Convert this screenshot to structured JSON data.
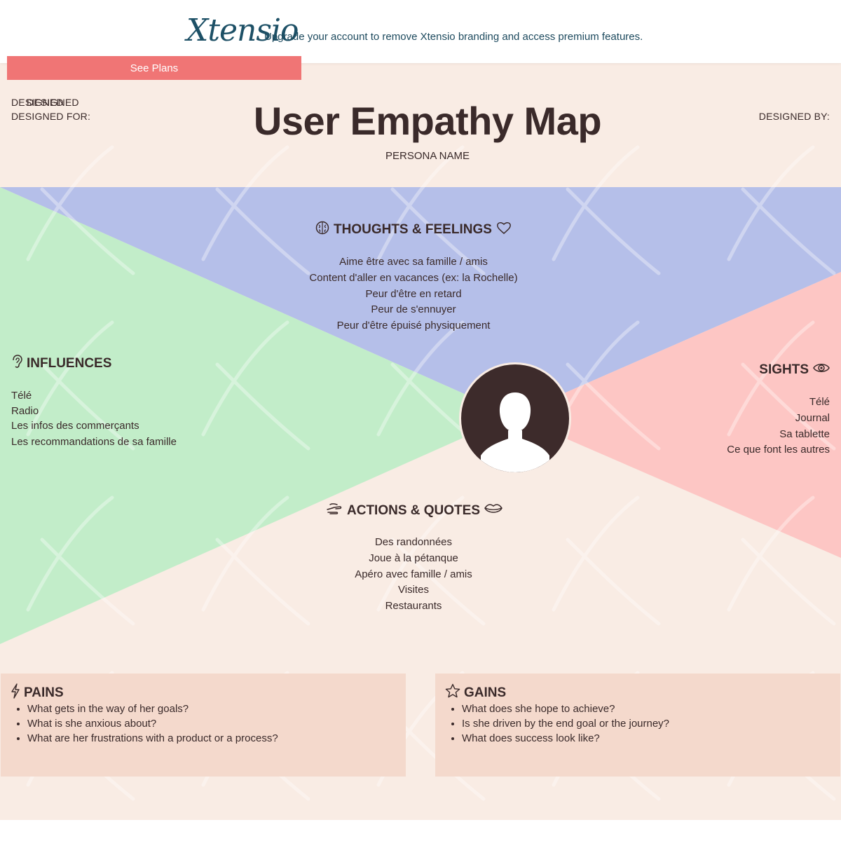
{
  "banner": {
    "logo_text": "Xtensio",
    "message": "Upgrade your account to remove Xtensio branding and access premium features.",
    "see_plans_label": "See Plans"
  },
  "header": {
    "designed_label_overlap": "DESIGNED",
    "designed_for_label": "DESIGNED FOR:",
    "designed_by_label": "DESIGNED BY:",
    "title": "User Empathy Map",
    "persona_name": "PERSONA NAME"
  },
  "sections": {
    "thoughts": {
      "title": "THOUGHTS & FEELINGS",
      "icon": "brain-icon",
      "icon_after": "heart-icon",
      "items": [
        "Aime être avec sa famille / amis",
        "Content d'aller en vacances (ex: la Rochelle)",
        "Peur d'être en retard",
        "Peur de s'ennuyer",
        "Peur d'être épuisé physiquement"
      ]
    },
    "influences": {
      "title": "INFLUENCES",
      "icon": "ear-icon",
      "items": [
        "Télé",
        "Radio",
        "Les infos des commerçants",
        "Les recommandations de sa famille"
      ]
    },
    "sights": {
      "title": "SIGHTS",
      "icon": "eye-icon",
      "items": [
        "Télé",
        "Journal",
        "Sa tablette",
        "Ce que font les autres"
      ]
    },
    "actions": {
      "title": "ACTIONS & QUOTES",
      "icon": "hand-icon",
      "icon_after": "lips-icon",
      "items": [
        "Des randonnées",
        "Joue à la pétanque",
        "Apéro avec famille / amis",
        "Visites",
        "Restaurants"
      ]
    }
  },
  "panels": {
    "pains": {
      "title": "PAINS",
      "icon": "lightning-icon",
      "items": [
        "What gets in the way of her goals?",
        "What is she anxious about?",
        "What are her frustrations with a product or a process?"
      ]
    },
    "gains": {
      "title": "GAINS",
      "icon": "star-icon",
      "items": [
        "What does she hope to achieve?",
        "Is she driven by the end goal or the journey?",
        "What does success look like?"
      ]
    }
  },
  "colors": {
    "thoughts_bg": "#b5bfe9",
    "influences_bg": "#c2edc9",
    "sights_bg": "#fdc6c4",
    "canvas_bg": "#f9ece4",
    "panel_bg": "#f4d9cc",
    "button_bg": "#f07575",
    "logo": "#1d5066",
    "text": "#3a2a2a"
  }
}
